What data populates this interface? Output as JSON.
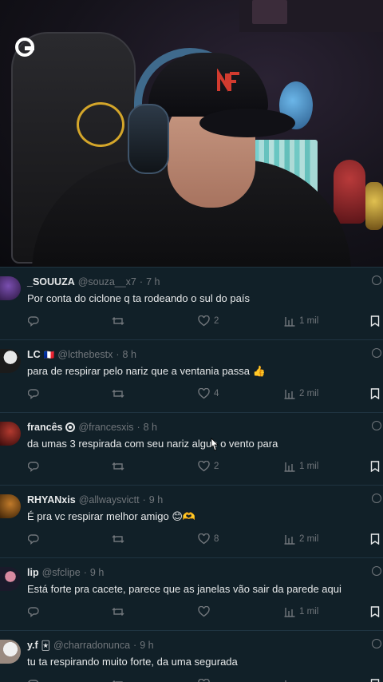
{
  "tweets": [
    {
      "name": "_SOUUZA",
      "handle": "@souza__x7",
      "time": "7 h",
      "text": "Por conta do ciclone q ta rodeando o sul do país",
      "likes": "2",
      "views": "1 mil",
      "flag": "",
      "verified": false,
      "emoji": ""
    },
    {
      "name": "LC",
      "handle": "@lcthebestx",
      "time": "8 h",
      "text": "para de respirar pelo nariz que a ventania passa",
      "likes": "4",
      "views": "2 mil",
      "flag": "🇫🇷",
      "verified": false,
      "emoji": "👍"
    },
    {
      "name": "francês",
      "handle": "@francesxis",
      "time": "8 h",
      "text": "da umas 3 respirada com seu nariz algue o vento para",
      "likes": "2",
      "views": "1 mil",
      "flag": "",
      "verified": true,
      "emoji": ""
    },
    {
      "name": "RHYANxis",
      "handle": "@allwaysvictt",
      "time": "9 h",
      "text": "É pra vc respirar melhor amigo",
      "likes": "8",
      "views": "2 mil",
      "flag": "",
      "verified": false,
      "emoji": "😊🫶"
    },
    {
      "name": "lip",
      "handle": "@sfclipe",
      "time": "9 h",
      "text": "Está forte pra cacete, parece que as janelas vão sair da parede aqui",
      "likes": "",
      "views": "1 mil",
      "flag": "",
      "verified": false,
      "emoji": ""
    },
    {
      "name": "y.f",
      "handle": "@charradonunca",
      "time": "9 h",
      "text": "tu ta respirando muito forte, da uma segurada",
      "likes": "",
      "views": "",
      "flag": "🃏",
      "verified": false,
      "emoji": ""
    }
  ],
  "separator": "·",
  "colors": {
    "bg": "#112028",
    "text": "#e7e9ea",
    "muted": "#71767b"
  }
}
